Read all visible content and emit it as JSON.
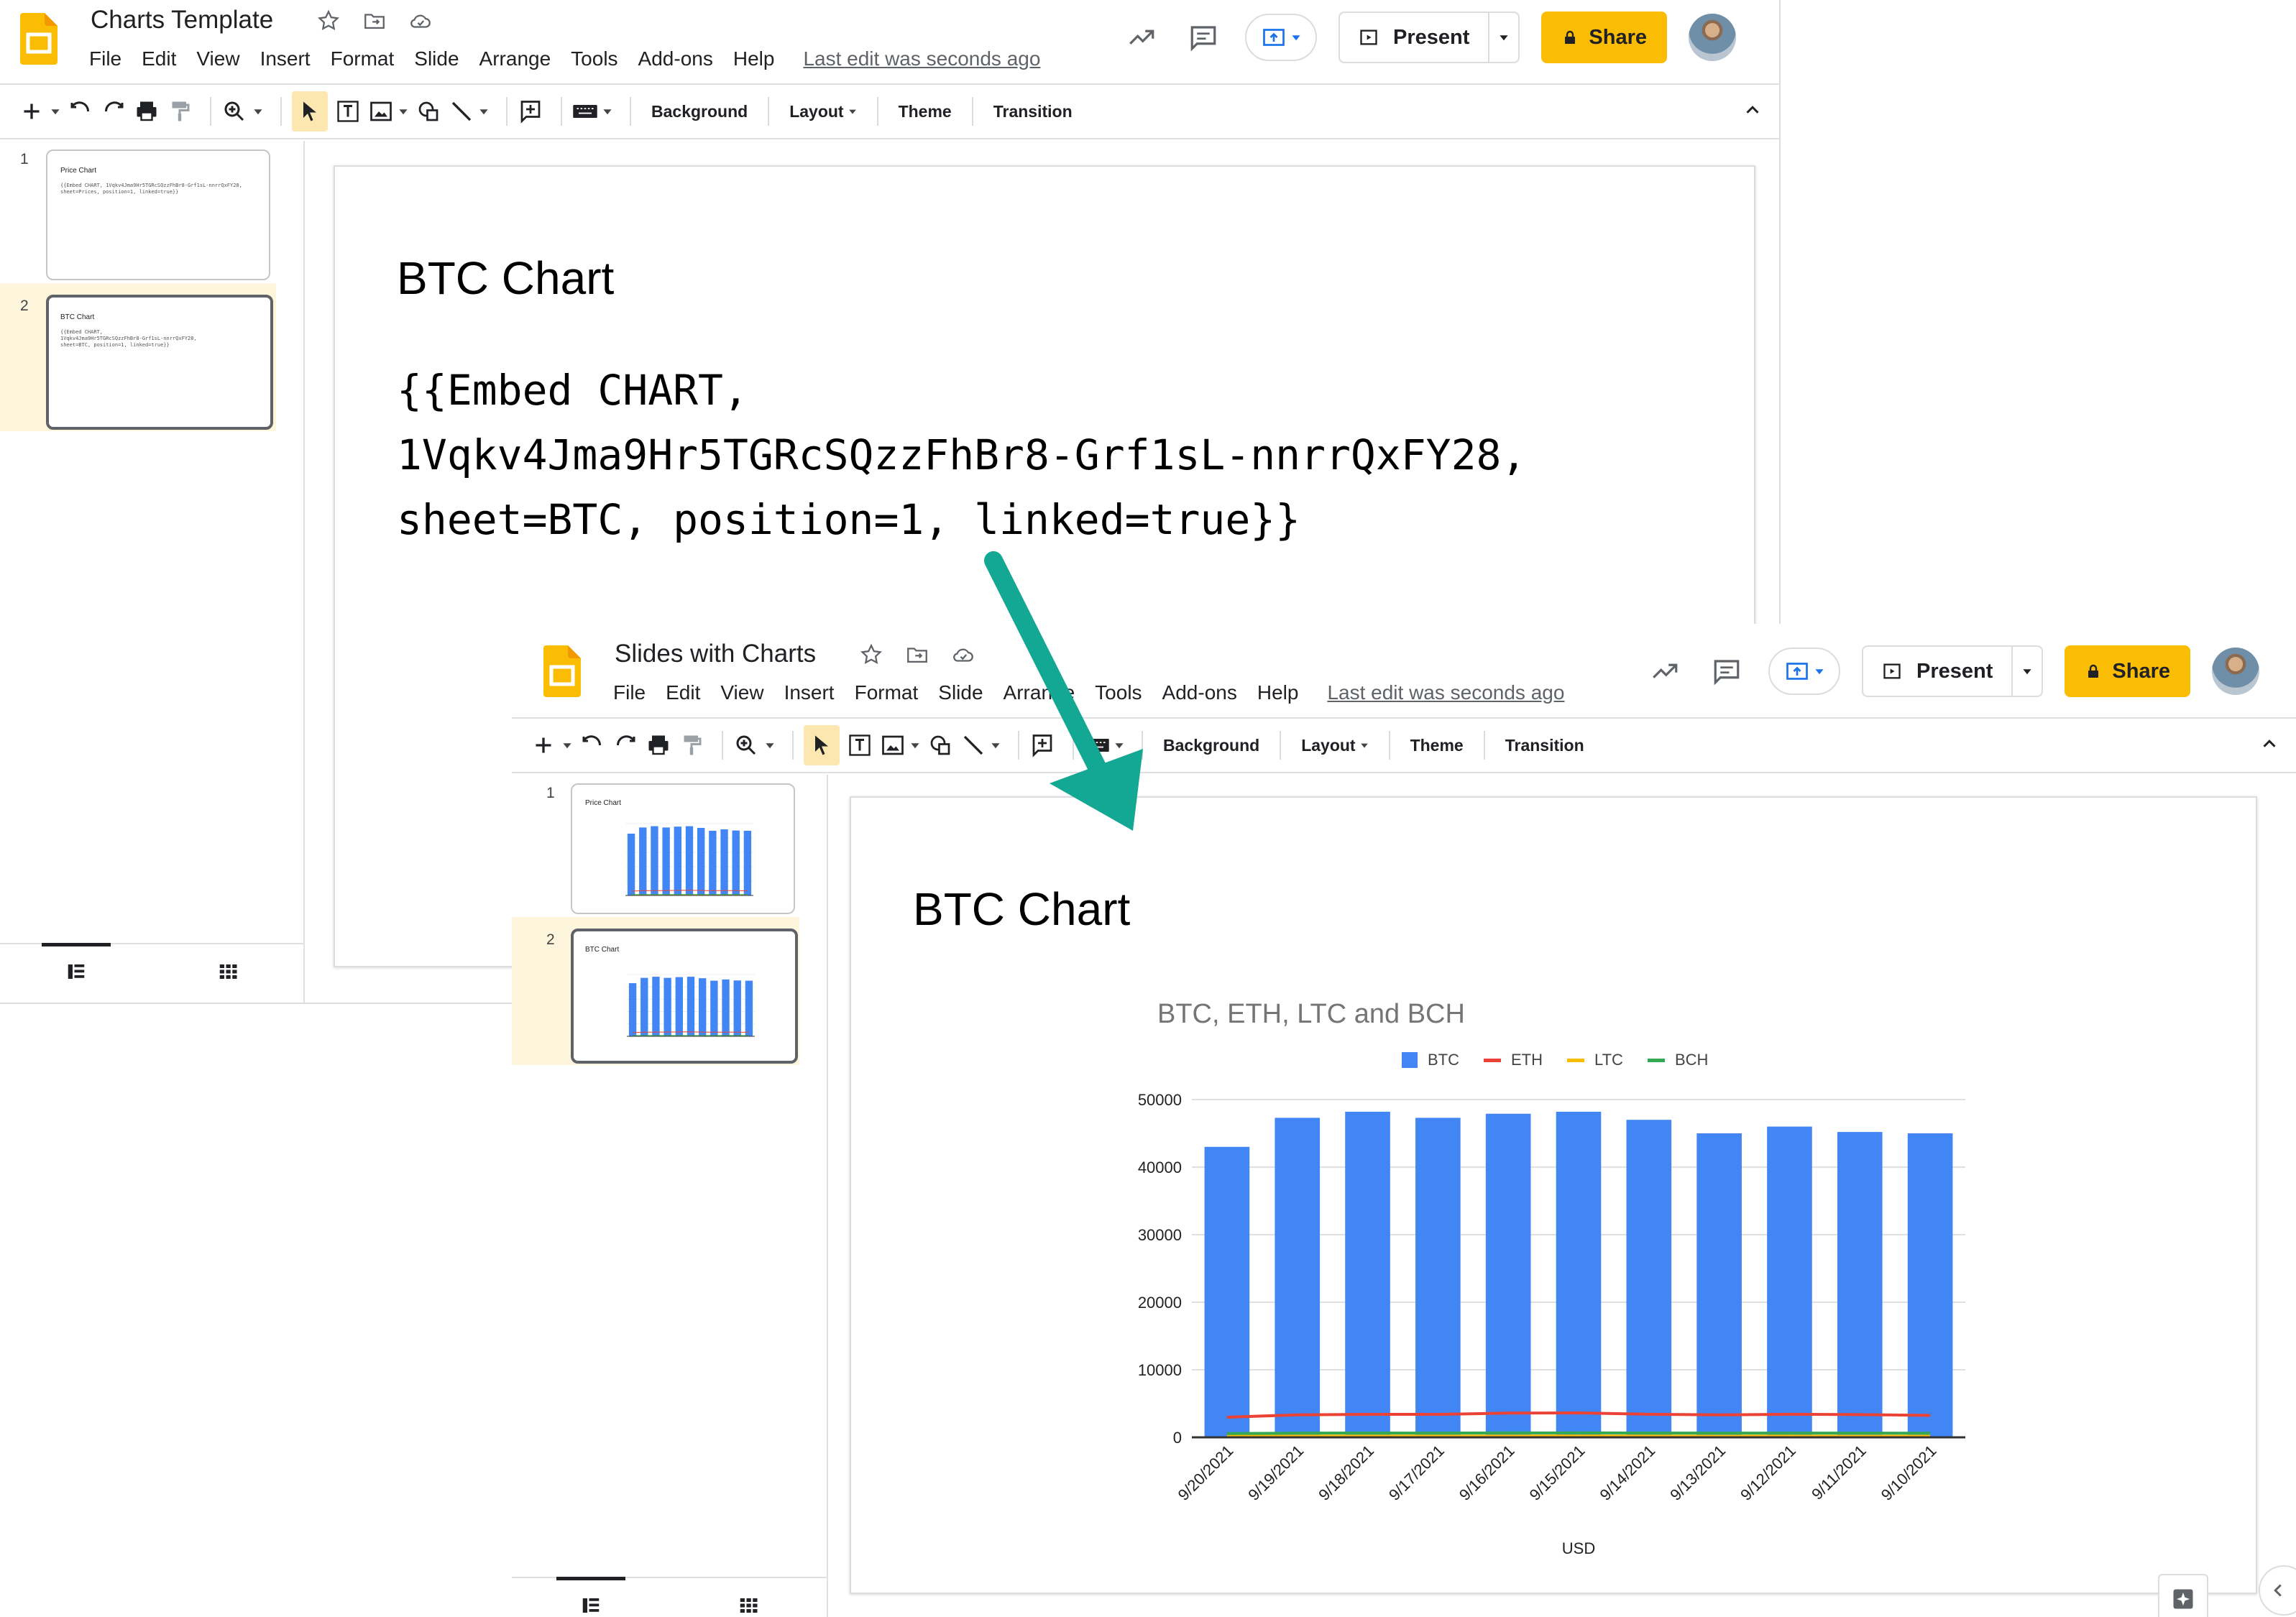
{
  "colors": {
    "accent_yellow": "#fbbc04",
    "btc_blue": "#4285f4",
    "eth_red": "#ea4335",
    "ltc_yellow": "#fbbc04",
    "bch_green": "#34a853",
    "arrow_teal": "#13a894"
  },
  "toolbar": {
    "background_label": "Background",
    "layout_label": "Layout",
    "theme_label": "Theme",
    "transition_label": "Transition"
  },
  "header": {
    "present_label": "Present",
    "share_label": "Share"
  },
  "menu": [
    "File",
    "Edit",
    "View",
    "Insert",
    "Format",
    "Slide",
    "Arrange",
    "Tools",
    "Add-ons",
    "Help"
  ],
  "window_template": {
    "doc_title": "Charts Template",
    "last_edit": "Last edit was seconds ago",
    "slides": [
      {
        "number": "1",
        "title": "Price Chart",
        "text": "{{Embed CHART, 1Vqkv4Jma9Hr5TGRcSQzzFhBr8-Grf1sL-nnrrQxFY28,\nsheet=Prices, position=1, linked=true}}"
      },
      {
        "number": "2",
        "title": "BTC Chart",
        "text": "{{Embed CHART,\n1Vqkv4Jma9Hr5TGRcSQzzFhBr8-Grf1sL-nnrrQxFY28,\nsheet=BTC, position=1, linked=true}}"
      }
    ],
    "current_slide": {
      "title": "BTC Chart",
      "line1": "{{Embed CHART,",
      "line2": "1Vqkv4Jma9Hr5TGRcSQzzFhBr8-Grf1sL-nnrrQxFY28,",
      "line3": "sheet=BTC, position=1, linked=true}}"
    }
  },
  "window_result": {
    "doc_title": "Slides with Charts",
    "last_edit": "Last edit was seconds ago",
    "slides": [
      {
        "number": "1",
        "title": "Price Chart"
      },
      {
        "number": "2",
        "title": "BTC Chart"
      }
    ],
    "current_slide": {
      "title": "BTC Chart"
    }
  },
  "chart_data": {
    "type": "bar",
    "title": "BTC, ETH, LTC and BCH",
    "xlabel": "USD",
    "ylabel": "",
    "ylim": [
      0,
      50000
    ],
    "yticks": [
      0,
      10000,
      20000,
      30000,
      40000,
      50000
    ],
    "grid": true,
    "legend_position": "top",
    "categories": [
      "9/20/2021",
      "9/19/2021",
      "9/18/2021",
      "9/17/2021",
      "9/16/2021",
      "9/15/2021",
      "9/14/2021",
      "9/13/2021",
      "9/12/2021",
      "9/11/2021",
      "9/10/2021"
    ],
    "series": [
      {
        "name": "BTC",
        "kind": "bar",
        "color": "#4285f4",
        "values": [
          43000,
          47300,
          48200,
          47300,
          47900,
          48200,
          47000,
          45000,
          46000,
          45200,
          45000
        ]
      },
      {
        "name": "ETH",
        "kind": "line",
        "color": "#ea4335",
        "values": [
          2980,
          3330,
          3400,
          3400,
          3590,
          3620,
          3420,
          3320,
          3420,
          3360,
          3250
        ]
      },
      {
        "name": "LTC",
        "kind": "line",
        "color": "#fbbc04",
        "values": [
          160,
          180,
          185,
          180,
          190,
          195,
          185,
          175,
          180,
          178,
          175
        ]
      },
      {
        "name": "BCH",
        "kind": "line",
        "color": "#34a853",
        "values": [
          560,
          620,
          640,
          630,
          650,
          660,
          640,
          620,
          630,
          625,
          615
        ]
      }
    ]
  }
}
